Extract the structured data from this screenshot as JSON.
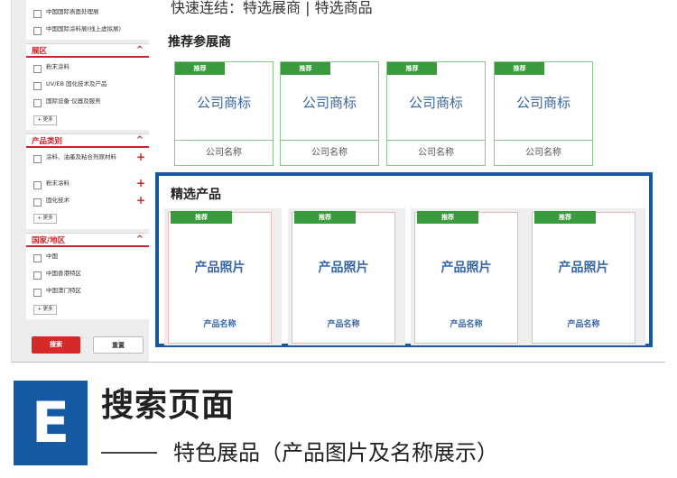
{
  "sidebar": {
    "top_options": [
      {
        "label": "中国国际表面处理展"
      },
      {
        "label": "中国国际涂料展(线上虚拟展)"
      }
    ],
    "sections": [
      {
        "title": "展区",
        "options": [
          {
            "label": "粉末涂料"
          },
          {
            "label": "UV/EB 固化技术及产品"
          },
          {
            "label": "国际设备·仪器及服务"
          }
        ],
        "more": "+ 更多"
      },
      {
        "title": "产品类别",
        "options": [
          {
            "label": "涂料、油墨及粘合剂原材料"
          },
          {
            "label": "粉末涂料"
          },
          {
            "label": "固化技术"
          }
        ],
        "more": "+ 更多"
      },
      {
        "title": "国家/地区",
        "options": [
          {
            "label": "中国"
          },
          {
            "label": "中国香港特区"
          },
          {
            "label": "中国澳门特区"
          }
        ],
        "more": "+ 更多"
      }
    ],
    "search_button": "搜索",
    "reset_button": "重置"
  },
  "main": {
    "quick_links": "快速连结：特选展商 | 特选商品",
    "exhibitors_title": "推荐参展商",
    "exhibitors": [
      {
        "badge": "推荐",
        "logo": "公司商标",
        "name": "公司名称"
      },
      {
        "badge": "推荐",
        "logo": "公司商标",
        "name": "公司名称"
      },
      {
        "badge": "推荐",
        "logo": "公司商标",
        "name": "公司名称"
      },
      {
        "badge": "推荐",
        "logo": "公司商标",
        "name": "公司名称"
      }
    ],
    "featured_title": "精选产品",
    "products": [
      {
        "badge": "推荐",
        "photo": "产品照片",
        "name": "产品名称"
      },
      {
        "badge": "推荐",
        "photo": "产品照片",
        "name": "产品名称"
      },
      {
        "badge": "推荐",
        "photo": "产品照片",
        "name": "产品名称"
      },
      {
        "badge": "推荐",
        "photo": "产品照片",
        "name": "产品名称"
      }
    ]
  },
  "caption": {
    "letter": "E",
    "title": "搜索页面",
    "subtitle": "特色展品（产品图片及名称展示）"
  },
  "colors": {
    "accent_red": "#c9252c",
    "badge_green": "#3a9b3e",
    "highlight_blue": "#1559a2",
    "text_blue": "#3867a8"
  }
}
